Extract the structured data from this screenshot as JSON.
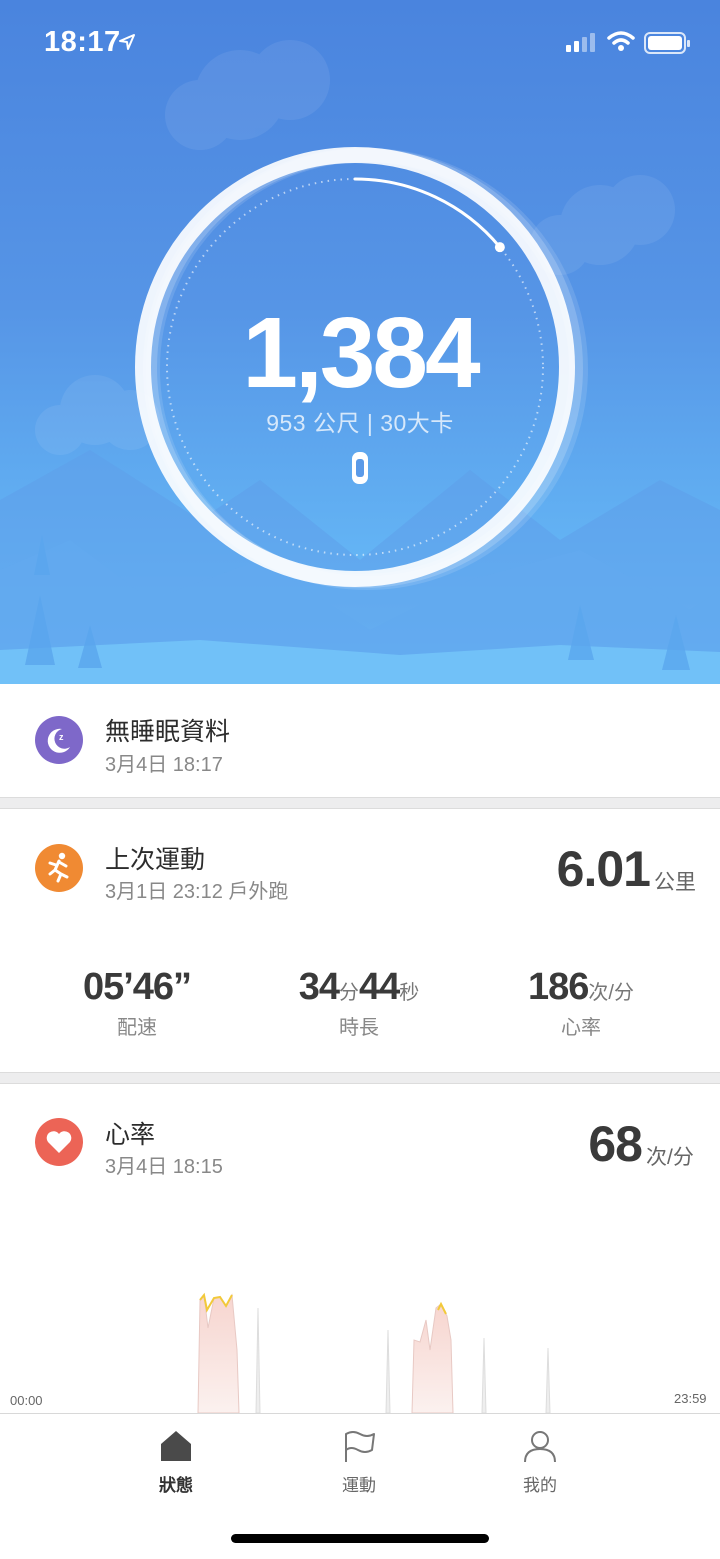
{
  "status_bar": {
    "time": "18:17",
    "icons": [
      "location-arrow-icon",
      "signal-icon",
      "wifi-icon",
      "battery-icon"
    ]
  },
  "activity": {
    "steps": "1,384",
    "summary": "953 公尺 | 30大卡",
    "progress_fraction": 0.14,
    "icon": "band-icon"
  },
  "sleep": {
    "title": "無睡眠資料",
    "time": "3月4日 18:17",
    "color": "#7e68c9",
    "icon": "moon-icon"
  },
  "last_workout": {
    "title": "上次運動",
    "subtitle": "3月1日 23:12 戶外跑",
    "distance": "6.01",
    "distance_unit": "公里",
    "color": "#f08a33",
    "icon": "runner-icon",
    "stats": [
      {
        "value": "05’46”",
        "label": "配速"
      },
      {
        "value_min": "34",
        "unit_min": "分",
        "value_sec": "44",
        "unit_sec": "秒",
        "label": "時長"
      },
      {
        "value": "186",
        "unit": "次/分",
        "label": "心率"
      }
    ]
  },
  "heart_rate": {
    "title": "心率",
    "time": "3月4日 18:15",
    "value": "68",
    "unit": "次/分",
    "color": "#ec6456",
    "icon": "heart-icon",
    "axis_start": "00:00",
    "axis_end": "23:59"
  },
  "tabs": [
    {
      "label": "狀態",
      "icon": "home-icon",
      "active": true
    },
    {
      "label": "運動",
      "icon": "flag-icon",
      "active": false
    },
    {
      "label": "我的",
      "icon": "profile-icon",
      "active": false
    }
  ]
}
